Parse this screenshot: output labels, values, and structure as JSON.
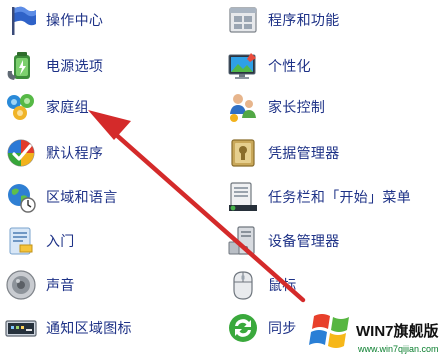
{
  "left_column": [
    {
      "label": "操作中心",
      "icon": "action-center-flag-icon"
    },
    {
      "label": "电源选项",
      "icon": "power-options-battery-icon"
    },
    {
      "label": "家庭组",
      "icon": "homegroup-icon"
    },
    {
      "label": "默认程序",
      "icon": "default-programs-icon"
    },
    {
      "label": "区域和语言",
      "icon": "region-language-globe-icon"
    },
    {
      "label": "入门",
      "icon": "getting-started-icon"
    },
    {
      "label": "声音",
      "icon": "sound-speaker-icon"
    },
    {
      "label": "通知区域图标",
      "icon": "notification-area-icon"
    }
  ],
  "right_column": [
    {
      "label": "程序和功能",
      "icon": "programs-features-icon"
    },
    {
      "label": "个性化",
      "icon": "personalization-icon"
    },
    {
      "label": "家长控制",
      "icon": "parental-controls-icon"
    },
    {
      "label": "凭据管理器",
      "icon": "credential-manager-icon"
    },
    {
      "label": "任务栏和「开始」菜单",
      "icon": "taskbar-start-menu-icon"
    },
    {
      "label": "设备管理器",
      "icon": "device-manager-icon"
    },
    {
      "label": "鼠标",
      "icon": "mouse-icon"
    },
    {
      "label": "同步",
      "icon": "sync-center-icon"
    }
  ],
  "watermark": {
    "title": "WIN7旗舰版",
    "url": "www.win7qijian.com"
  },
  "colors": {
    "link_text": "#1e3287",
    "arrow": "#d42a2a"
  }
}
